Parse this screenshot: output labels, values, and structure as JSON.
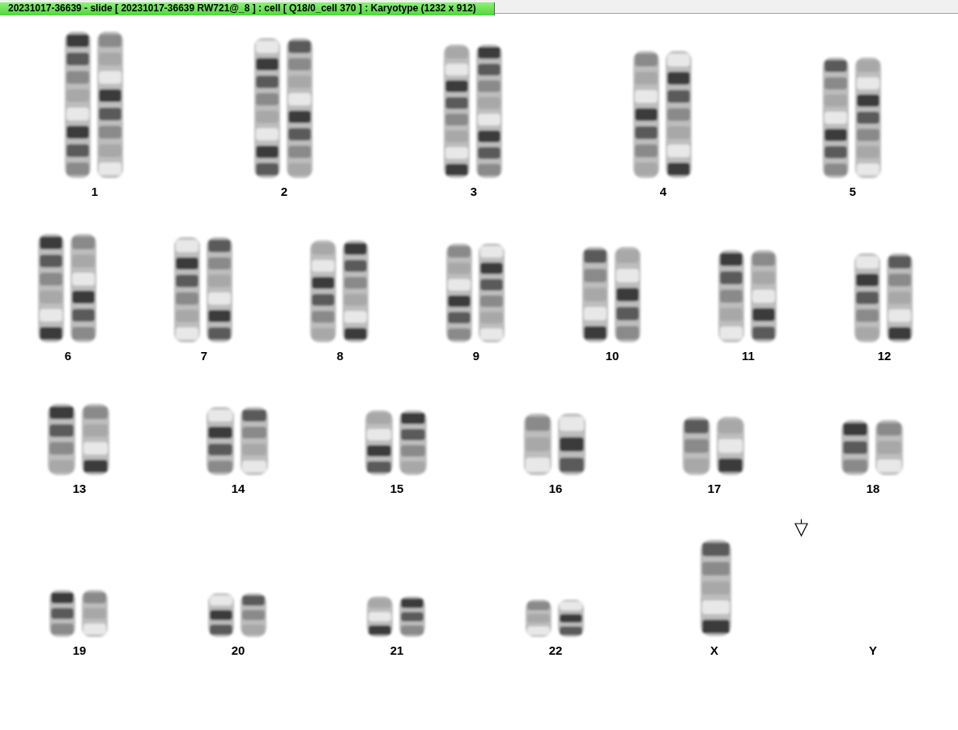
{
  "window": {
    "title": "20231017-36639 - slide [ 20231017-36639 RW721@_8 ] : cell [ Q18/0_cell 370 ] : Karyotype  (1232 x 912)"
  },
  "karyotype_rows": [
    {
      "items": [
        {
          "label": "1",
          "kind": "pair"
        },
        {
          "label": "2",
          "kind": "pair"
        },
        {
          "label": "3",
          "kind": "pair"
        },
        {
          "label": "4",
          "kind": "pair"
        },
        {
          "label": "5",
          "kind": "pair"
        }
      ]
    },
    {
      "items": [
        {
          "label": "6",
          "kind": "pair"
        },
        {
          "label": "7",
          "kind": "pair"
        },
        {
          "label": "8",
          "kind": "pair"
        },
        {
          "label": "9",
          "kind": "pair"
        },
        {
          "label": "10",
          "kind": "pair"
        },
        {
          "label": "11",
          "kind": "pair"
        },
        {
          "label": "12",
          "kind": "pair"
        }
      ]
    },
    {
      "items": [
        {
          "label": "13",
          "kind": "pair"
        },
        {
          "label": "14",
          "kind": "pair"
        },
        {
          "label": "15",
          "kind": "pair"
        },
        {
          "label": "16",
          "kind": "pair"
        },
        {
          "label": "17",
          "kind": "pair"
        },
        {
          "label": "18",
          "kind": "pair"
        }
      ]
    },
    {
      "items": [
        {
          "label": "19",
          "kind": "pair"
        },
        {
          "label": "20",
          "kind": "pair"
        },
        {
          "label": "21",
          "kind": "pair"
        },
        {
          "label": "22",
          "kind": "pair"
        },
        {
          "label": "X",
          "kind": "single"
        },
        {
          "label": "Y",
          "kind": "none"
        }
      ]
    }
  ]
}
